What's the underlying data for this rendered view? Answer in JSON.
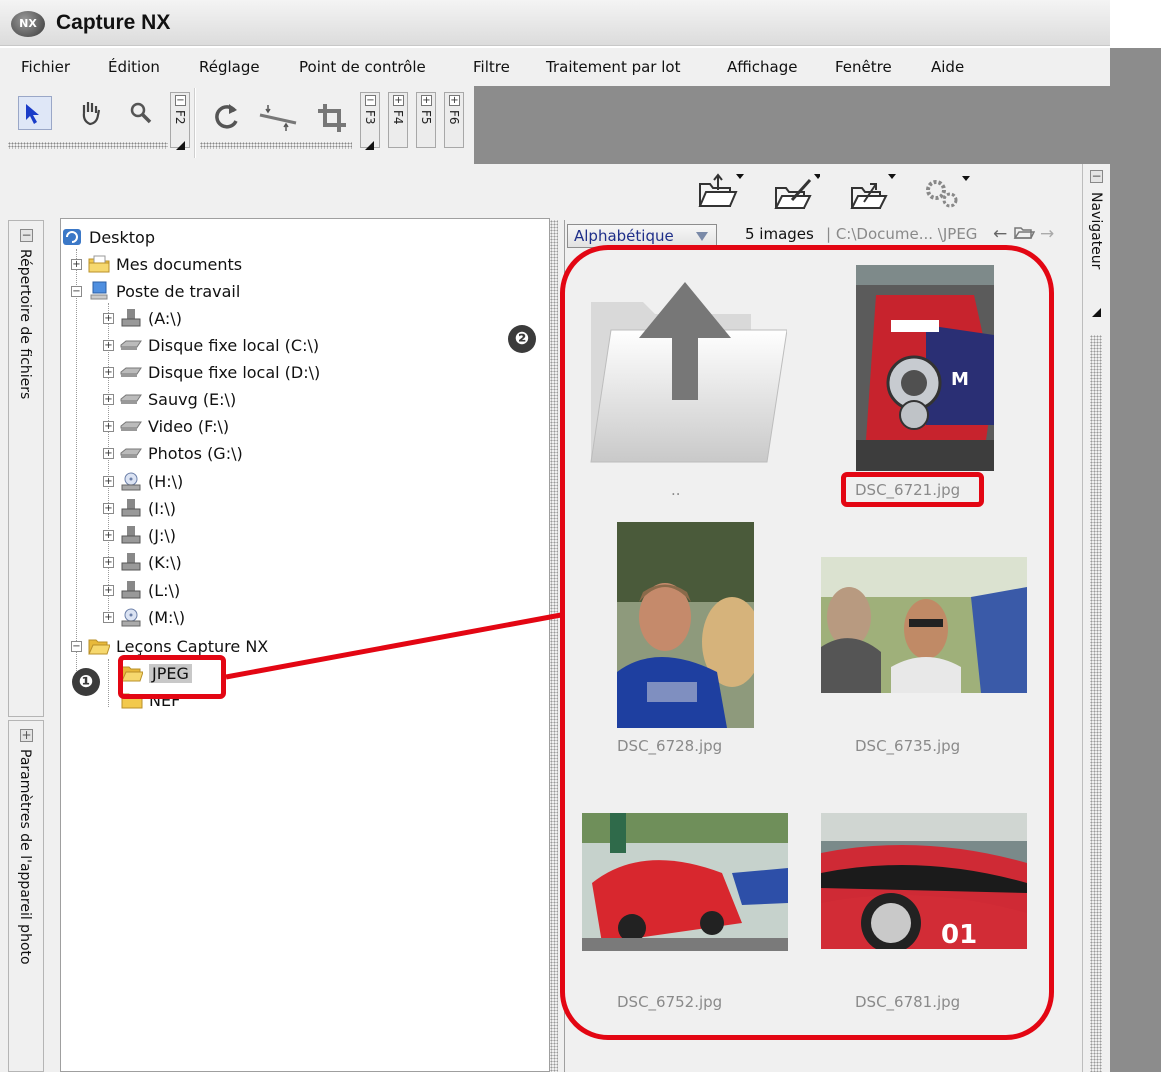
{
  "window": {
    "title": "Capture NX",
    "logo": "NX"
  },
  "menu": [
    "Fichier",
    "Édition",
    "Réglage",
    "Point de contrôle",
    "Filtre",
    "Traitement par lot",
    "Affichage",
    "Fenêtre",
    "Aide"
  ],
  "toolbar": {
    "tools": [
      "arrow-select-icon",
      "hand-pan-icon",
      "zoom-icon",
      "rotate-icon",
      "straighten-icon",
      "crop-icon"
    ],
    "fkey_tabs": [
      "F2",
      "F3",
      "F4",
      "F5",
      "F6"
    ]
  },
  "side_tabs": {
    "file_directory": "Répertoire de fichiers",
    "camera_settings": "Paramètres de l'appareil photo",
    "navigator": "Navigateur"
  },
  "tree": [
    {
      "label": "Desktop",
      "icon": "desktop-icon"
    },
    {
      "label": "Mes documents",
      "icon": "folder-icon",
      "expander": "+"
    },
    {
      "label": "Poste de travail",
      "icon": "computer-icon",
      "expander": "−"
    },
    {
      "label": "(A:\\)",
      "icon": "floppy-drive-icon",
      "expander": "+"
    },
    {
      "label": "Disque fixe local (C:\\)",
      "icon": "hard-drive-icon",
      "expander": "+"
    },
    {
      "label": "Disque fixe local (D:\\)",
      "icon": "hard-drive-icon",
      "expander": "+"
    },
    {
      "label": "Sauvg (E:\\)",
      "icon": "hard-drive-icon",
      "expander": "+"
    },
    {
      "label": "Video (F:\\)",
      "icon": "hard-drive-icon",
      "expander": "+"
    },
    {
      "label": "Photos (G:\\)",
      "icon": "hard-drive-icon",
      "expander": "+"
    },
    {
      "label": "(H:\\)",
      "icon": "cd-drive-icon",
      "expander": "+"
    },
    {
      "label": "(I:\\)",
      "icon": "removable-drive-icon",
      "expander": "+"
    },
    {
      "label": "(J:\\)",
      "icon": "removable-drive-icon",
      "expander": "+"
    },
    {
      "label": "(K:\\)",
      "icon": "removable-drive-icon",
      "expander": "+"
    },
    {
      "label": "(L:\\)",
      "icon": "removable-drive-icon",
      "expander": "+"
    },
    {
      "label": "(M:\\)",
      "icon": "cd-drive-icon",
      "expander": "+"
    },
    {
      "label": "Leçons Capture NX",
      "icon": "open-folder-icon",
      "expander": "−"
    },
    {
      "label": "JPEG",
      "icon": "open-folder-icon",
      "selected": true
    },
    {
      "label": "NEF",
      "icon": "folder-icon"
    }
  ],
  "browser": {
    "sort": "Alphabétique",
    "count": "5 images",
    "path": "| C:\\Docume... \\JPEG",
    "up_folder_caption": "..",
    "images": [
      "DSC_6721.jpg",
      "DSC_6728.jpg",
      "DSC_6735.jpg",
      "DSC_6752.jpg",
      "DSC_6781.jpg"
    ]
  },
  "annotations": {
    "badge_1": "❶",
    "badge_2": "❷"
  },
  "colors": {
    "highlight": "#e30613",
    "panel": "#f0f0f0",
    "workspace": "#8c8c8c"
  }
}
